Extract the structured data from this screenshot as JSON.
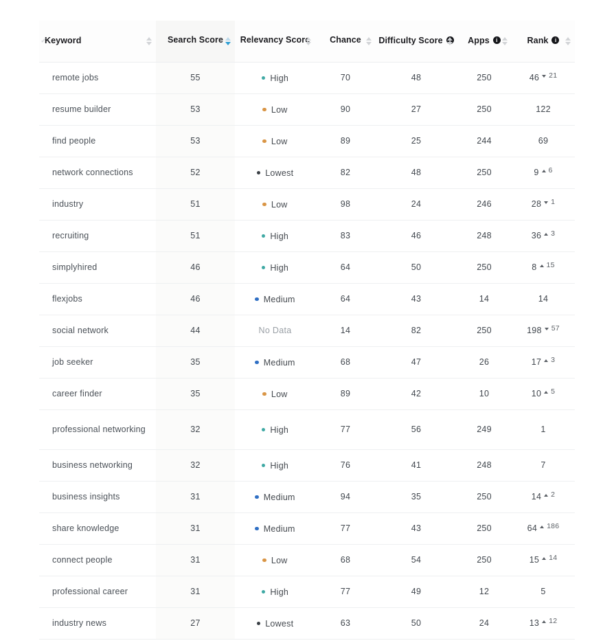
{
  "table": {
    "columns": [
      {
        "key": "keyword",
        "label": "Keyword",
        "has_info": false,
        "sortable": true,
        "sorted": false,
        "align": "left",
        "wrap": false
      },
      {
        "key": "search",
        "label": "Search Score",
        "has_info": true,
        "sortable": true,
        "sorted": true,
        "align": "center",
        "wrap": true
      },
      {
        "key": "relevancy",
        "label": "Relevancy Score",
        "has_info": true,
        "sortable": true,
        "sorted": false,
        "align": "center",
        "wrap": true
      },
      {
        "key": "chance",
        "label": "Chance",
        "has_info": true,
        "sortable": true,
        "sorted": false,
        "align": "center",
        "wrap": true
      },
      {
        "key": "difficulty",
        "label": "Difficulty Score",
        "has_info": true,
        "sortable": true,
        "sorted": false,
        "align": "center",
        "wrap": false
      },
      {
        "key": "apps",
        "label": "Apps",
        "has_info": true,
        "sortable": true,
        "sorted": false,
        "align": "center",
        "wrap": false
      },
      {
        "key": "rank",
        "label": "Rank",
        "has_info": true,
        "sortable": true,
        "sorted": false,
        "align": "center",
        "wrap": false
      }
    ],
    "sort": {
      "column": "Search Score",
      "direction": "desc"
    },
    "relevancy_colors": {
      "High": "#3fa9a4",
      "Medium": "#2f6fc4",
      "Low": "#d99545",
      "Lowest": "#3a3f45",
      "No Data": "#9aa0a6"
    },
    "no_data_label": "No Data",
    "rows": [
      {
        "keyword": "remote jobs",
        "search": "55",
        "relevancy": "High",
        "chance": "70",
        "difficulty": "48",
        "apps": "250",
        "rank": "46",
        "rank_delta": "21",
        "rank_dir": "down"
      },
      {
        "keyword": "resume builder",
        "search": "53",
        "relevancy": "Low",
        "chance": "90",
        "difficulty": "27",
        "apps": "250",
        "rank": "122",
        "rank_delta": "",
        "rank_dir": "none"
      },
      {
        "keyword": "find people",
        "search": "53",
        "relevancy": "Low",
        "chance": "89",
        "difficulty": "25",
        "apps": "244",
        "rank": "69",
        "rank_delta": "",
        "rank_dir": "none"
      },
      {
        "keyword": "network connections",
        "search": "52",
        "relevancy": "Lowest",
        "chance": "82",
        "difficulty": "48",
        "apps": "250",
        "rank": "9",
        "rank_delta": "6",
        "rank_dir": "up"
      },
      {
        "keyword": "industry",
        "search": "51",
        "relevancy": "Low",
        "chance": "98",
        "difficulty": "24",
        "apps": "246",
        "rank": "28",
        "rank_delta": "1",
        "rank_dir": "down"
      },
      {
        "keyword": "recruiting",
        "search": "51",
        "relevancy": "High",
        "chance": "83",
        "difficulty": "46",
        "apps": "248",
        "rank": "36",
        "rank_delta": "3",
        "rank_dir": "up"
      },
      {
        "keyword": "simplyhired",
        "search": "46",
        "relevancy": "High",
        "chance": "64",
        "difficulty": "50",
        "apps": "250",
        "rank": "8",
        "rank_delta": "15",
        "rank_dir": "up"
      },
      {
        "keyword": "flexjobs",
        "search": "46",
        "relevancy": "Medium",
        "chance": "64",
        "difficulty": "43",
        "apps": "14",
        "rank": "14",
        "rank_delta": "",
        "rank_dir": "none"
      },
      {
        "keyword": "social network",
        "search": "44",
        "relevancy": "No Data",
        "chance": "14",
        "difficulty": "82",
        "apps": "250",
        "rank": "198",
        "rank_delta": "57",
        "rank_dir": "down"
      },
      {
        "keyword": "job seeker",
        "search": "35",
        "relevancy": "Medium",
        "chance": "68",
        "difficulty": "47",
        "apps": "26",
        "rank": "17",
        "rank_delta": "3",
        "rank_dir": "up"
      },
      {
        "keyword": "career finder",
        "search": "35",
        "relevancy": "Low",
        "chance": "89",
        "difficulty": "42",
        "apps": "10",
        "rank": "10",
        "rank_delta": "5",
        "rank_dir": "up"
      },
      {
        "keyword": "professional networking",
        "search": "32",
        "relevancy": "High",
        "chance": "77",
        "difficulty": "56",
        "apps": "249",
        "rank": "1",
        "rank_delta": "",
        "rank_dir": "none"
      },
      {
        "keyword": "business networking",
        "search": "32",
        "relevancy": "High",
        "chance": "76",
        "difficulty": "41",
        "apps": "248",
        "rank": "7",
        "rank_delta": "",
        "rank_dir": "none"
      },
      {
        "keyword": "business insights",
        "search": "31",
        "relevancy": "Medium",
        "chance": "94",
        "difficulty": "35",
        "apps": "250",
        "rank": "14",
        "rank_delta": "2",
        "rank_dir": "up"
      },
      {
        "keyword": "share knowledge",
        "search": "31",
        "relevancy": "Medium",
        "chance": "77",
        "difficulty": "43",
        "apps": "250",
        "rank": "64",
        "rank_delta": "186",
        "rank_dir": "up"
      },
      {
        "keyword": "connect people",
        "search": "31",
        "relevancy": "Low",
        "chance": "68",
        "difficulty": "54",
        "apps": "250",
        "rank": "15",
        "rank_delta": "14",
        "rank_dir": "up"
      },
      {
        "keyword": "professional career",
        "search": "31",
        "relevancy": "High",
        "chance": "77",
        "difficulty": "49",
        "apps": "12",
        "rank": "5",
        "rank_delta": "",
        "rank_dir": "none"
      },
      {
        "keyword": "industry news",
        "search": "27",
        "relevancy": "Lowest",
        "chance": "63",
        "difficulty": "50",
        "apps": "24",
        "rank": "13",
        "rank_delta": "12",
        "rank_dir": "up"
      }
    ]
  }
}
